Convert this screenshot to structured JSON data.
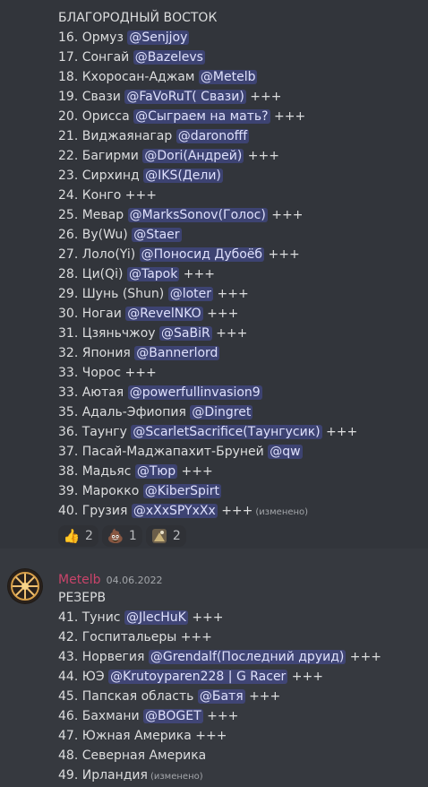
{
  "message1": {
    "title": "БЛАГОРОДНЫЙ ВОСТОК",
    "lines": [
      {
        "text": "16. Ормуз   ",
        "mention": "@Senjjoy",
        "suffix": ""
      },
      {
        "text": "17. Сонгай   ",
        "mention": "@Bazelevs",
        "suffix": ""
      },
      {
        "text": "18. Кхоросан-Аджам ",
        "mention": "@Metelb",
        "suffix": ""
      },
      {
        "text": "19. Свази   ",
        "mention": "@FaVoRuT( Свази)",
        "suffix": " +++"
      },
      {
        "text": "20. Орисса   ",
        "mention": "@Сыграем на мать?",
        "suffix": " +++"
      },
      {
        "text": "21. Виджаянагар   ",
        "mention": "@daronofff",
        "suffix": ""
      },
      {
        "text": "22. Багирми   ",
        "mention": "@Dori(Андрей)",
        "suffix": " +++"
      },
      {
        "text": "23. Сирхинд   ",
        "mention": "@IKS(Дели)",
        "suffix": ""
      },
      {
        "text": "24. Конго    +++",
        "mention": "",
        "suffix": ""
      },
      {
        "text": "25. Мевар   ",
        "mention": "@MarksSonov(Голос)",
        "suffix": " +++"
      },
      {
        "text": "26. Ву(Wu)   ",
        "mention": "@Staer",
        "suffix": ""
      },
      {
        "text": "27. Лоло(Yi)   ",
        "mention": "@Поносид Дубоёб",
        "suffix": " +++"
      },
      {
        "text": "28. Ци(Qi)   ",
        "mention": "@Tapok",
        "suffix": " +++"
      },
      {
        "text": "29. Шунь (Shun)   ",
        "mention": "@loter",
        "suffix": " +++"
      },
      {
        "text": "30. Ногаи   ",
        "mention": "@RevelNKO",
        "suffix": " +++"
      },
      {
        "text": "31. Цзяньчжоу ",
        "mention": "@SaBiR",
        "suffix": " +++"
      },
      {
        "text": "32. Япония   ",
        "mention": "@Bannerlord",
        "suffix": ""
      },
      {
        "text": "33. Чорос    +++",
        "mention": "",
        "suffix": ""
      },
      {
        "text": "33. Аютая   ",
        "mention": "@powerfullinvasion9",
        "suffix": ""
      },
      {
        "text": "35. Адаль-Эфиопия   ",
        "mention": "@Dingret",
        "suffix": ""
      },
      {
        "text": "36. Таунгу   ",
        "mention": "@ScarletSacrifice(Таунгусик)",
        "suffix": " +++"
      },
      {
        "text": "37. Пасай-Маджапахит-Бруней   ",
        "mention": "@qw",
        "suffix": ""
      },
      {
        "text": "38. Мадьяс   ",
        "mention": "@Тюр",
        "suffix": " +++"
      },
      {
        "text": "39. Марокко   ",
        "mention": "@KiberSpirt",
        "suffix": ""
      },
      {
        "text": "40. Грузия   ",
        "mention": "@xXxSPYxXx",
        "suffix": " +++"
      }
    ],
    "edited_label": "(изменено)",
    "reactions": [
      {
        "icon": "thumbs-up-icon",
        "glyph": "👍",
        "count": "2"
      },
      {
        "icon": "poop-icon",
        "glyph": "💩",
        "count": "1"
      },
      {
        "icon": "custom-emoji-icon",
        "glyph": "",
        "count": "2"
      }
    ]
  },
  "message2": {
    "username": "Metelb",
    "timestamp": "04.06.2022",
    "username_color": "#c9446a",
    "title": "РЕЗЕРВ",
    "lines": [
      {
        "text": "41. Тунис ",
        "mention": "@JlecHuK",
        "suffix": " +++"
      },
      {
        "text": "42. Госпитальеры +++",
        "mention": "",
        "suffix": ""
      },
      {
        "text": "43. Норвегия ",
        "mention": "@Grendalf(Последний друид)",
        "suffix": " +++"
      },
      {
        "text": "44. ЮЭ ",
        "mention": "@Krutoyparen228 | G Racer",
        "suffix": " +++"
      },
      {
        "text": "45. Папская область ",
        "mention": "@Батя",
        "suffix": " +++"
      },
      {
        "text": "46. Бахмани ",
        "mention": "@BOGET",
        "suffix": " +++"
      },
      {
        "text": "47. Южная Америка +++",
        "mention": "",
        "suffix": ""
      },
      {
        "text": "48. Северная Америка",
        "mention": "",
        "suffix": ""
      },
      {
        "text": "49. Ирландия",
        "mention": "",
        "suffix": ""
      }
    ],
    "edited_label": "(изменено)"
  },
  "colors": {
    "background": "#36393f",
    "mention_bg": "rgba(88,101,242,0.30)",
    "mention_text": "#dee0fc"
  }
}
